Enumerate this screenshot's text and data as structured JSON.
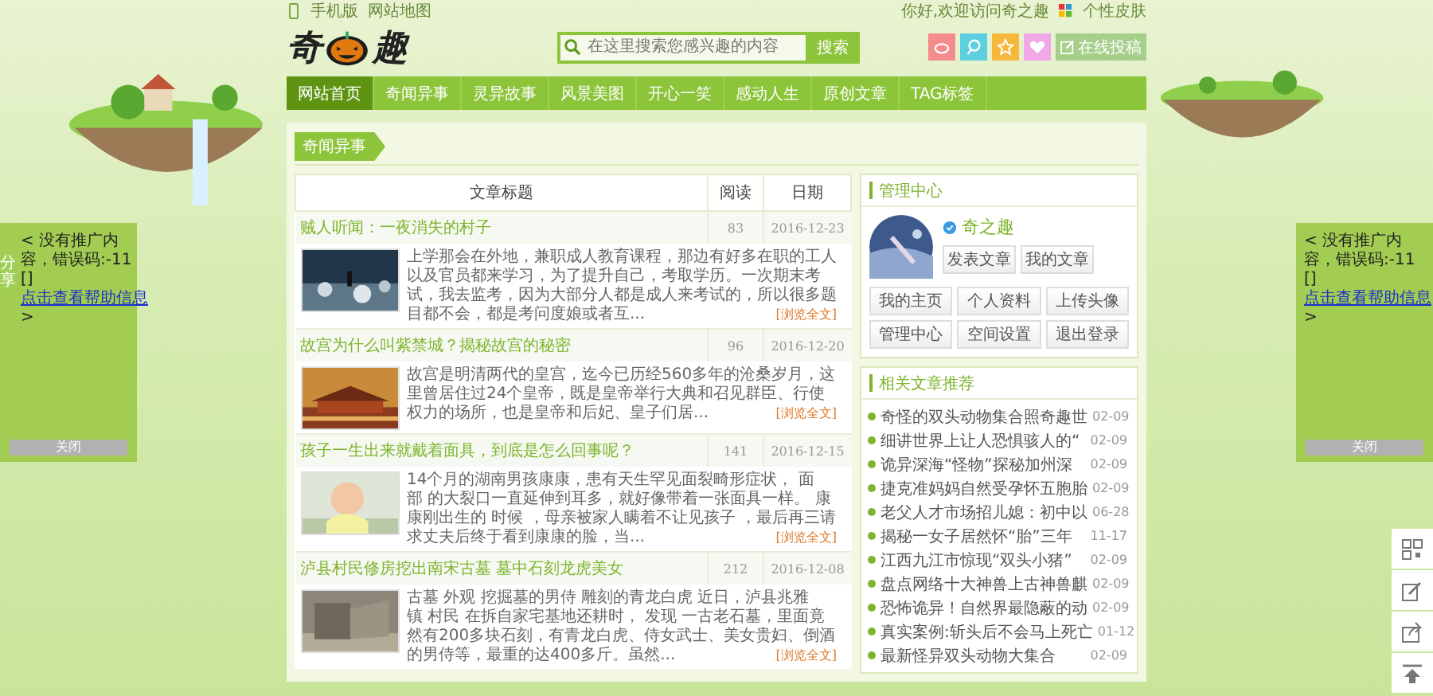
{
  "topbar": {
    "links": [
      "手机版",
      "网站地图"
    ],
    "greeting": "你好,欢迎访问奇之趣",
    "skin": "个性皮肤"
  },
  "logo": {
    "chars": [
      "奇",
      "趣"
    ]
  },
  "search": {
    "placeholder": "在这里搜索您感兴趣的内容",
    "button": "搜索"
  },
  "submit_button": "在线投稿",
  "nav": [
    {
      "label": "网站首页",
      "selected": true
    },
    {
      "label": "奇闻异事",
      "selected": false
    },
    {
      "label": "灵异故事",
      "selected": false
    },
    {
      "label": "风景美图",
      "selected": false
    },
    {
      "label": "开心一笑",
      "selected": false
    },
    {
      "label": "感动人生",
      "selected": false
    },
    {
      "label": "原创文章",
      "selected": false
    },
    {
      "label": "TAG标签",
      "selected": false
    }
  ],
  "section_title": "奇闻异事",
  "table": {
    "columns": [
      "文章标题",
      "阅读",
      "日期"
    ],
    "rows": [
      {
        "title": "贼人听闻：一夜消失的村子",
        "reads": "83",
        "date": "2016-12-23",
        "excerpt": "上学那会在外地，兼职成人教育课程，那边有好多在职的工人以及官员都来学习，为了提升自己，考取学历。一次期末考试，我去监考，因为大部分人都是成人来考试的，所以很多题目都不会，都是考问度娘或者互...",
        "more": "[浏览全文]",
        "image": {
          "kind": "picture"
        }
      },
      {
        "title": "故宫为什么叫紫禁城？揭秘故宫的秘密",
        "reads": "96",
        "date": "2016-12-20",
        "excerpt": "故宫是明清两代的皇宫，迄今已历经560多年的沧桑岁月，这里曾居住过24个皇帝，既是皇帝举行大典和召见群臣、行使权力的场所，也是皇帝和后妃、皇子们居...",
        "more": "[浏览全文]",
        "image": {
          "kind": "picture"
        }
      },
      {
        "title": "孩子一生出来就戴着面具，到底是怎么回事呢？",
        "reads": "141",
        "date": "2016-12-15",
        "excerpt": "14个月的湖南男孩康康，患有天生罕见面裂畸形症状， 面部 的大裂口一直延伸到耳多，就好像带着一张面具一样。 康康刚出生的 时候 ，母亲被家人瞒着不让见孩子 ，最后再三请求丈夫后终于看到康康的脸，当...",
        "more": "[浏览全文]",
        "image": {
          "kind": "picture"
        }
      },
      {
        "title": "泸县村民修房挖出南宋古墓 墓中石刻龙虎美女",
        "reads": "212",
        "date": "2016-12-08",
        "excerpt": "古墓 外观 挖掘墓的男侍 雕刻的青龙白虎 近日，泸县兆雅镇 村民 在拆自家宅基地还耕时， 发现 一古老石墓，里面竟然有200多块石刻，有青龙白虎、侍女武士、美女贵妇、倒酒的男侍等，最重的达400多斤。虽然...",
        "more": "[浏览全文]",
        "image": {
          "kind": "picture"
        }
      }
    ]
  },
  "admin": {
    "title": "管理中心",
    "username": "奇之趣",
    "avatar": {
      "kind": "picture"
    },
    "primary_buttons": [
      "发表文章",
      "我的文章"
    ],
    "buttons": [
      "我的主页",
      "个人资料",
      "上传头像",
      "管理中心",
      "空间设置",
      "退出登录"
    ]
  },
  "related": {
    "title": "相关文章推荐",
    "items": [
      {
        "title": "奇怪的双头动物集合照奇趣世",
        "date": "02-09"
      },
      {
        "title": "细讲世界上让人恐惧骇人的“",
        "date": "02-09"
      },
      {
        "title": "诡异深海“怪物”探秘加州深",
        "date": "02-09"
      },
      {
        "title": "捷克准妈妈自然受孕怀五胞胎",
        "date": "02-09"
      },
      {
        "title": "老父人才市场招儿媳：初中以",
        "date": "06-28"
      },
      {
        "title": "揭秘一女子居然怀“胎”三年",
        "date": "11-17"
      },
      {
        "title": "江西九江市惊现“双头小猪”",
        "date": "02-09"
      },
      {
        "title": "盘点网络十大神兽上古神兽麒",
        "date": "02-09"
      },
      {
        "title": "恐怖诡异！自然界最隐蔽的动",
        "date": "02-09"
      },
      {
        "title": "真实案例:斩头后不会马上死亡",
        "date": "01-12"
      },
      {
        "title": "最新怪异双头动物大集合",
        "date": "02-09"
      }
    ]
  },
  "side_ads": [
    {
      "text": "< 没有推广内容，错误码:-11 []",
      "link": "点击查看帮助信息",
      "tail": ">",
      "close": "关闭",
      "share_tab": "分享"
    },
    {
      "text": "< 没有推广内容，错误码:-11 []",
      "link": "点击查看帮助信息",
      "tail": ">",
      "close": "关闭"
    }
  ],
  "tools": [
    {
      "kind": "qr"
    },
    {
      "kind": "edit"
    },
    {
      "kind": "share"
    },
    {
      "kind": "top"
    }
  ]
}
